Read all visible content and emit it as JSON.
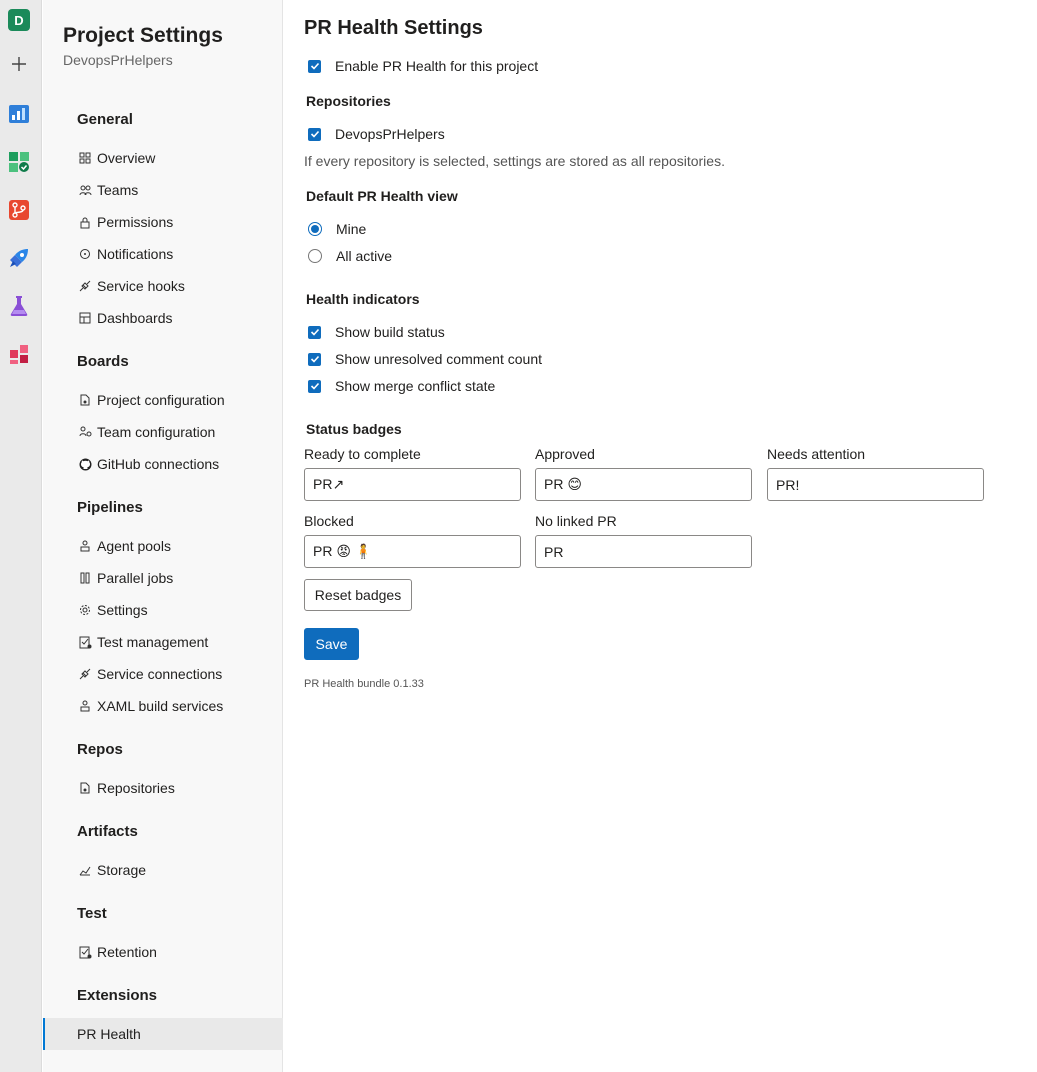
{
  "rail": {
    "org_initial": "D",
    "icons": [
      "plus-icon",
      "overview-icon",
      "boards-icon",
      "repos-icon",
      "pipelines-icon",
      "test-plans-icon",
      "artifacts-icon"
    ]
  },
  "nav": {
    "title": "Project Settings",
    "subtitle": "DevopsPrHelpers",
    "sections": {
      "general": "General",
      "boards": "Boards",
      "pipelines": "Pipelines",
      "repos": "Repos",
      "artifacts": "Artifacts",
      "test": "Test",
      "extensions": "Extensions"
    },
    "items": {
      "overview": "Overview",
      "teams": "Teams",
      "permissions": "Permissions",
      "notifications": "Notifications",
      "service_hooks": "Service hooks",
      "dashboards": "Dashboards",
      "project_configuration": "Project configuration",
      "team_configuration": "Team configuration",
      "github_connections": "GitHub connections",
      "agent_pools": "Agent pools",
      "parallel_jobs": "Parallel jobs",
      "settings": "Settings",
      "test_management": "Test management",
      "service_connections": "Service connections",
      "xaml_build_services": "XAML build services",
      "repositories": "Repositories",
      "storage": "Storage",
      "retention": "Retention",
      "pr_health": "PR Health"
    },
    "selected": "PR Health"
  },
  "main": {
    "title": "PR Health Settings",
    "enable_label": "Enable PR Health for this project",
    "repositories_heading": "Repositories",
    "repo_name": "DevopsPrHelpers",
    "repo_hint": "If every repository is selected, settings are stored as all repositories.",
    "default_view_heading": "Default PR Health view",
    "view_options": [
      "Mine",
      "All active"
    ],
    "view_selected": "Mine",
    "indicators_heading": "Health indicators",
    "indicators": [
      "Show build status",
      "Show unresolved comment count",
      "Show merge conflict state"
    ],
    "badges_heading": "Status badges",
    "badges": {
      "ready": {
        "label": "Ready to complete",
        "value": "PR↗"
      },
      "approved": {
        "label": "Approved",
        "value": "PR 😊"
      },
      "attention": {
        "label": "Needs attention",
        "value": "PR!"
      },
      "blocked": {
        "label": "Blocked",
        "value": "PR 😡 🧍"
      },
      "nolink": {
        "label": "No linked PR",
        "value": "PR"
      }
    },
    "reset_label": "Reset badges",
    "save_label": "Save",
    "version": "PR Health bundle 0.1.33"
  },
  "colors": {
    "accent": "#0f6cbd",
    "org_avatar": "#1b8a5a"
  }
}
